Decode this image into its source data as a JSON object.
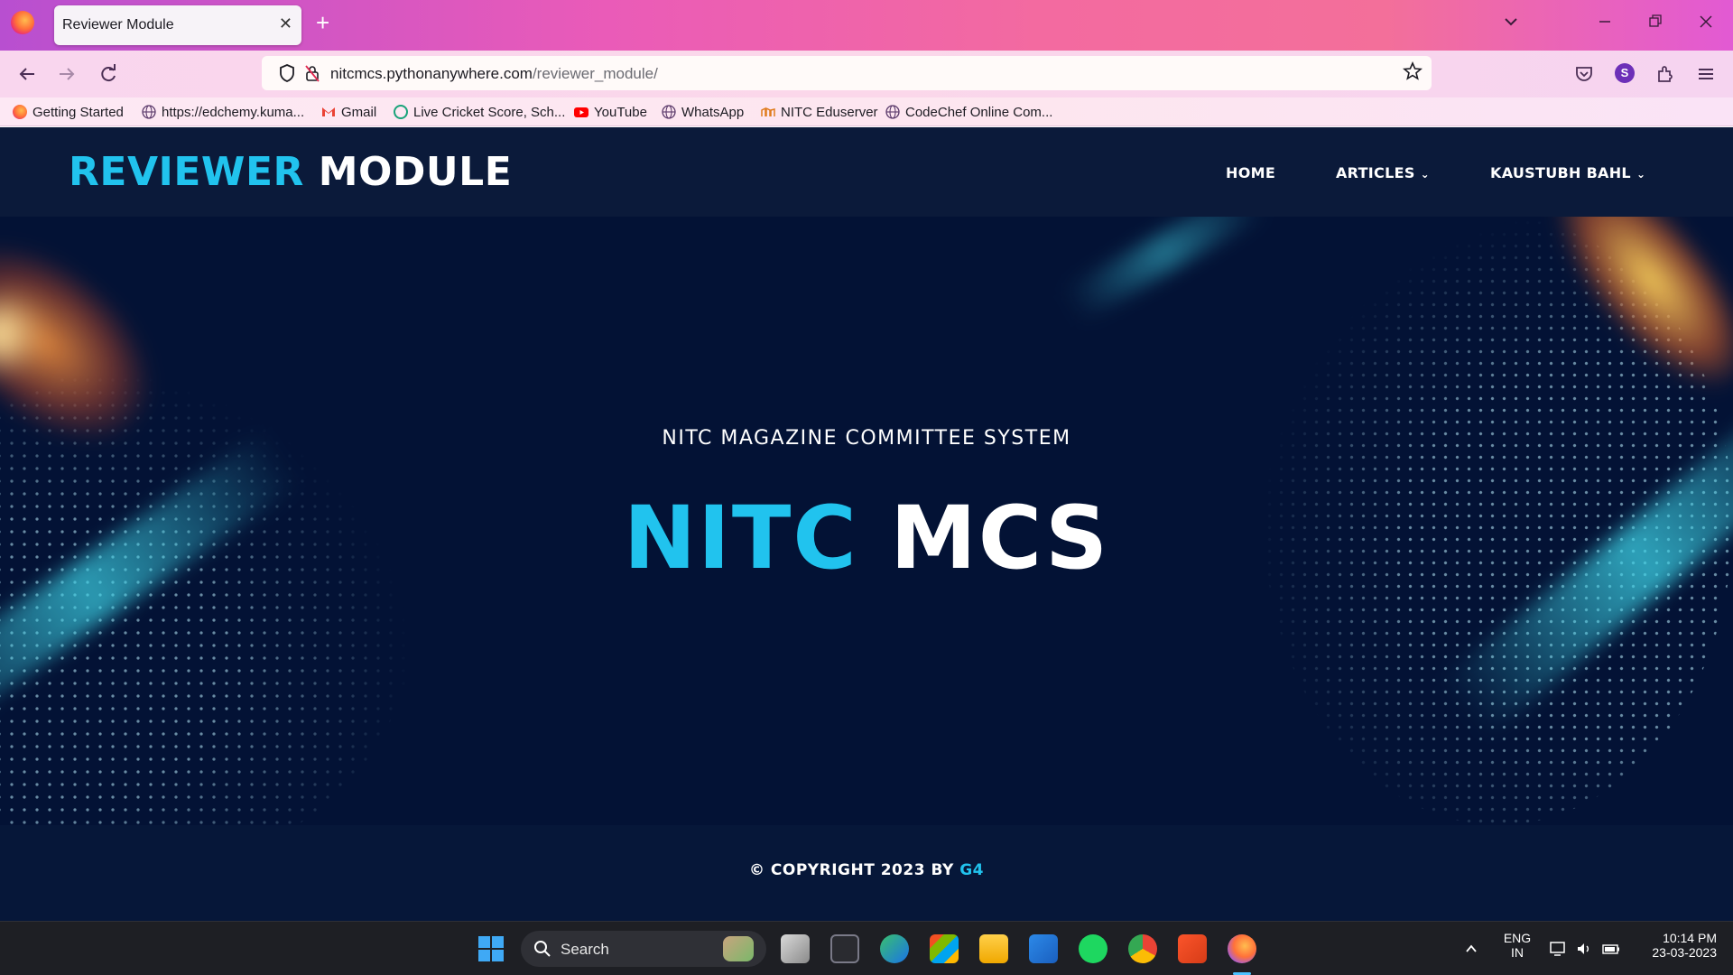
{
  "browser": {
    "tab_title": "Reviewer Module",
    "tab_close": "✕",
    "new_tab": "+",
    "url_host": "nitcmcs.pythonanywhere.com",
    "url_path": "/reviewer_module/",
    "profile_initial": "S",
    "bookmarks": [
      {
        "label": "Getting Started",
        "icon": "firefox-icon"
      },
      {
        "label": "https://edchemy.kuma...",
        "icon": "globe-icon"
      },
      {
        "label": "Gmail",
        "icon": "gmail-icon"
      },
      {
        "label": "Live Cricket Score, Sch...",
        "icon": "cricbuzz-icon"
      },
      {
        "label": "YouTube",
        "icon": "youtube-icon"
      },
      {
        "label": "WhatsApp",
        "icon": "globe-icon"
      },
      {
        "label": "NITC Eduserver",
        "icon": "eduserver-icon"
      },
      {
        "label": "CodeChef Online Com...",
        "icon": "globe-icon"
      }
    ]
  },
  "site": {
    "brand_part1": "REVIEWER",
    "brand_part2": "MODULE",
    "menu": {
      "home": "HOME",
      "articles": "ARTICLES",
      "user": "KAUSTUBH BAHL"
    },
    "hero_subtitle": "NITC MAGAZINE COMMITTEE SYSTEM",
    "hero_title_part1": "NITC",
    "hero_title_part2": "MCS",
    "footer_text": "© COPYRIGHT 2023 BY",
    "footer_link": "G4",
    "colors": {
      "accent": "#21c3ee",
      "background": "#031235",
      "header": "#0b1a3a"
    }
  },
  "taskbar": {
    "search_label": "Search",
    "lang_top": "ENG",
    "lang_bottom": "IN",
    "time": "10:14 PM",
    "date": "23-03-2023"
  }
}
